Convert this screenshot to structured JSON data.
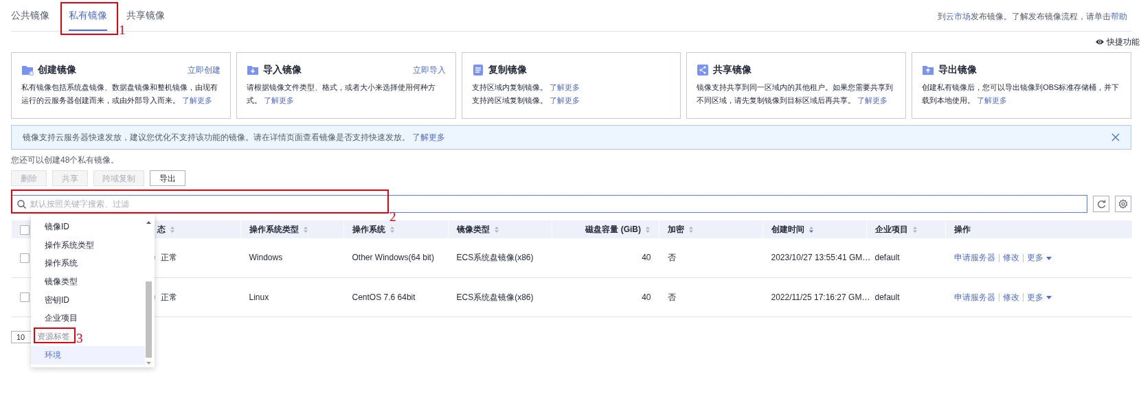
{
  "tabs": [
    {
      "label": "公共镜像",
      "selected": false
    },
    {
      "label": "私有镜像",
      "selected": true
    },
    {
      "label": "共享镜像",
      "selected": false
    }
  ],
  "publish_note": [
    {
      "text": "到"
    },
    {
      "link": "云市场"
    },
    {
      "text": "发布镜像。了解发布镜像流程，请单击"
    },
    {
      "link": "帮助"
    }
  ],
  "quick_functions": {
    "label": "快捷功能"
  },
  "cards": [
    {
      "title": "创建镜像",
      "action": "立即创建",
      "lines": [
        {
          "text": "私有镜像包括系统盘镜像、数据盘镜像和整机镜像，由现有运行的云服务器创建而来，或由外部导入而来。",
          "link": "了解更多"
        }
      ]
    },
    {
      "title": "导入镜像",
      "action": "立即导入",
      "lines": [
        {
          "text": "请根据镜像文件类型、格式，或者大小来选择使用何种方式。",
          "link": "了解更多"
        }
      ]
    },
    {
      "title": "复制镜像",
      "lines": [
        {
          "text": "支持区域内复制镜像。",
          "link": "了解更多"
        },
        {
          "text": "支持跨区域复制镜像。",
          "link": "了解更多"
        }
      ]
    },
    {
      "title": "共享镜像",
      "lines": [
        {
          "text": "镜像支持共享到同一区域内的其他租户。如果您需要共享到不同区域，请先复制镜像到目标区域后再共享。",
          "link": "了解更多"
        }
      ]
    },
    {
      "title": "导出镜像",
      "lines": [
        {
          "text": "创建私有镜像后，您可以导出镜像到OBS标准存储桶，并下载到本地使用。",
          "link": "了解更多"
        }
      ]
    }
  ],
  "alert": {
    "text": "镜像支持云服务器快速发放，建议您优化不支持该功能的镜像。请在详情页面查看镜像是否支持快速发放。",
    "link": "了解更多"
  },
  "quota_note": "您还可以创建48个私有镜像。",
  "buttons": [
    {
      "label": "删除",
      "disabled": true
    },
    {
      "label": "共享",
      "disabled": true
    },
    {
      "label": "跨域复制",
      "disabled": true
    },
    {
      "label": "导出",
      "disabled": false
    }
  ],
  "search": {
    "placeholder": "默认按照关键字搜索、过滤",
    "focused": true
  },
  "table": {
    "select_all_checked": false,
    "columns": [
      {
        "label": "态",
        "sortable": true
      },
      {
        "label": "操作系统类型",
        "sortable": true
      },
      {
        "label": "操作系统",
        "sortable": true
      },
      {
        "label": "镜像类型",
        "sortable": true
      },
      {
        "label": "磁盘容量 (GiB)",
        "sortable": true
      },
      {
        "label": "加密",
        "sortable": true
      },
      {
        "label": "创建时间",
        "sortable": true,
        "sorted_desc": true
      },
      {
        "label": "企业项目",
        "sortable": true
      },
      {
        "label": "操作",
        "sortable": false
      }
    ],
    "rows": [
      {
        "checked": false,
        "cells": [
          "正常",
          "Windows",
          "Other Windows(64 bit)",
          "ECS系统盘镜像(x86)",
          "40",
          "否",
          "2023/10/27 13:55:41 GM…",
          "default"
        ],
        "actions": [
          {
            "label": "申请服务器",
            "kind": "link"
          },
          {
            "label": "修改",
            "kind": "link"
          },
          {
            "label": "更多",
            "kind": "menu"
          }
        ]
      },
      {
        "checked": false,
        "cells": [
          "正常",
          "Linux",
          "CentOS 7.6 64bit",
          "ECS系统盘镜像(x86)",
          "40",
          "否",
          "2022/11/25 17:16:27 GM…",
          "default"
        ],
        "actions": [
          {
            "label": "申请服务器",
            "kind": "link"
          },
          {
            "label": "修改",
            "kind": "link"
          },
          {
            "label": "更多",
            "kind": "menu"
          }
        ]
      }
    ]
  },
  "page_size": "10",
  "filter_menu": {
    "items": [
      {
        "label": "镜像ID",
        "kind": "option",
        "selected": false
      },
      {
        "label": "操作系统类型",
        "kind": "option",
        "selected": false
      },
      {
        "label": "操作系统",
        "kind": "option",
        "selected": false
      },
      {
        "label": "镜像类型",
        "kind": "option",
        "selected": false
      },
      {
        "label": "密钥ID",
        "kind": "option",
        "selected": false
      },
      {
        "label": "企业项目",
        "kind": "option",
        "selected": false
      },
      {
        "label": "资源标签",
        "kind": "group",
        "selected": false
      },
      {
        "label": "环境",
        "kind": "option",
        "selected": true
      }
    ]
  },
  "annotations": [
    {
      "label": "1"
    },
    {
      "label": "2"
    },
    {
      "label": "3"
    }
  ]
}
